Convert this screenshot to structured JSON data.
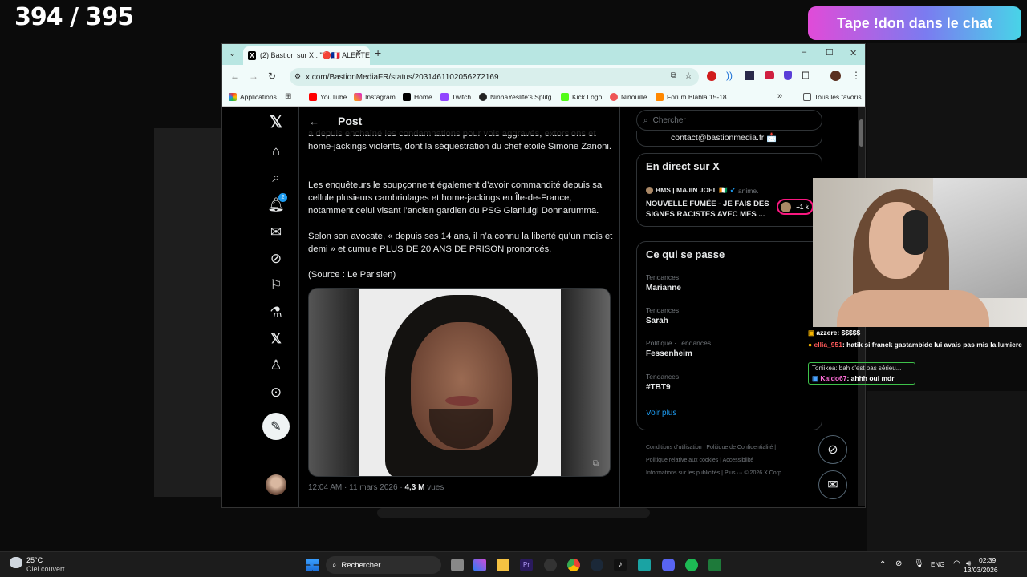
{
  "stream": {
    "counter": "394 / 395",
    "don_banner": "Tape !don dans le chat"
  },
  "browser": {
    "tab_title": "(2) Bastion sur X : \"🔴🇫🇷 ALERTE",
    "url": "x.com/BastionMediaFR/status/2031461102056272169",
    "bookmarks": [
      "Applications",
      "YouTube",
      "Instagram",
      "Home",
      "Twitch",
      "NinhaYeslife's Splitg...",
      "Kick Logo",
      "Ninouille",
      "Forum Blabla 15-18...",
      "Tous les favoris"
    ]
  },
  "x": {
    "header_title": "Post",
    "notif_count": "2",
    "post_paragraphs": [
      "a depuis enchaîné les condamnations pour vols aggravés, extorsions et home-jackings violents, dont la séquestration du chef étoilé Simone Zanoni.",
      "Les enquêteurs le soupçonnent également d’avoir commandité depuis sa cellule plusieurs cambriolages et home-jackings en Île-de-France, notamment celui visant l’ancien gardien du PSG Gianluigi Donnarumma.",
      "Selon son avocate, « depuis ses 14 ans, il n’a connu la liberté qu’un mois et demi » et cumule PLUS DE 20 ANS DE PRISON prononcés.",
      "(Source : Le Parisien)"
    ],
    "post_time": "12:04 AM · 11 mars 2026 · ",
    "post_views_count": "4,3 M",
    "post_views_label": "vues",
    "search_placeholder": "Chercher",
    "contact": "contact@bastionmedia.fr 📩",
    "live": {
      "title": "En direct sur X",
      "host": "BMS | MAJIN JOEL 🇨🇮",
      "host_tag": "anime.",
      "stream_title": "NOUVELLE FUMÉE - JE FAIS DES SIGNES RACISTES AVEC MES ...",
      "viewers": "+1 k"
    },
    "trends": {
      "title": "Ce qui se passe",
      "items": [
        {
          "context": "Tendances",
          "name": "Marianne"
        },
        {
          "context": "Tendances",
          "name": "Sarah"
        },
        {
          "context": "Politique · Tendances",
          "name": "Fessenheim"
        },
        {
          "context": "Tendances",
          "name": "#TBT9"
        }
      ],
      "more": "Voir plus"
    },
    "footer": [
      "Conditions d’utilisation",
      "Politique de Confidentialité",
      "Politique relative aux cookies",
      "Accessibilité",
      "Informations sur les publicités",
      "Plus ···",
      "© 2026 X Corp."
    ]
  },
  "chat": [
    {
      "user": "azzere",
      "text": ": $$$$$",
      "color": "#ffffff"
    },
    {
      "user": "ellia_951",
      "text": ": hatik si franck gastambide lui avais pas mis la lumiere",
      "color": "#ff5a5a"
    },
    {
      "reply": "Toniikea: bah c'est pas sérieu...",
      "user": "Kaido67",
      "text": ": ahhh oui mdr",
      "color": "#ff6fd8"
    }
  ],
  "taskbar": {
    "temp": "25°C",
    "weather": "Ciel couvert",
    "search": "Rechercher",
    "lang": "ENG",
    "time": "02:39",
    "date": "13/03/2026"
  },
  "colors": {
    "x_blue": "#1d9bf0",
    "tab_bg": "#b8e6e2",
    "banner_pink": "#e14bd8",
    "banner_cyan": "#48d4e8"
  }
}
